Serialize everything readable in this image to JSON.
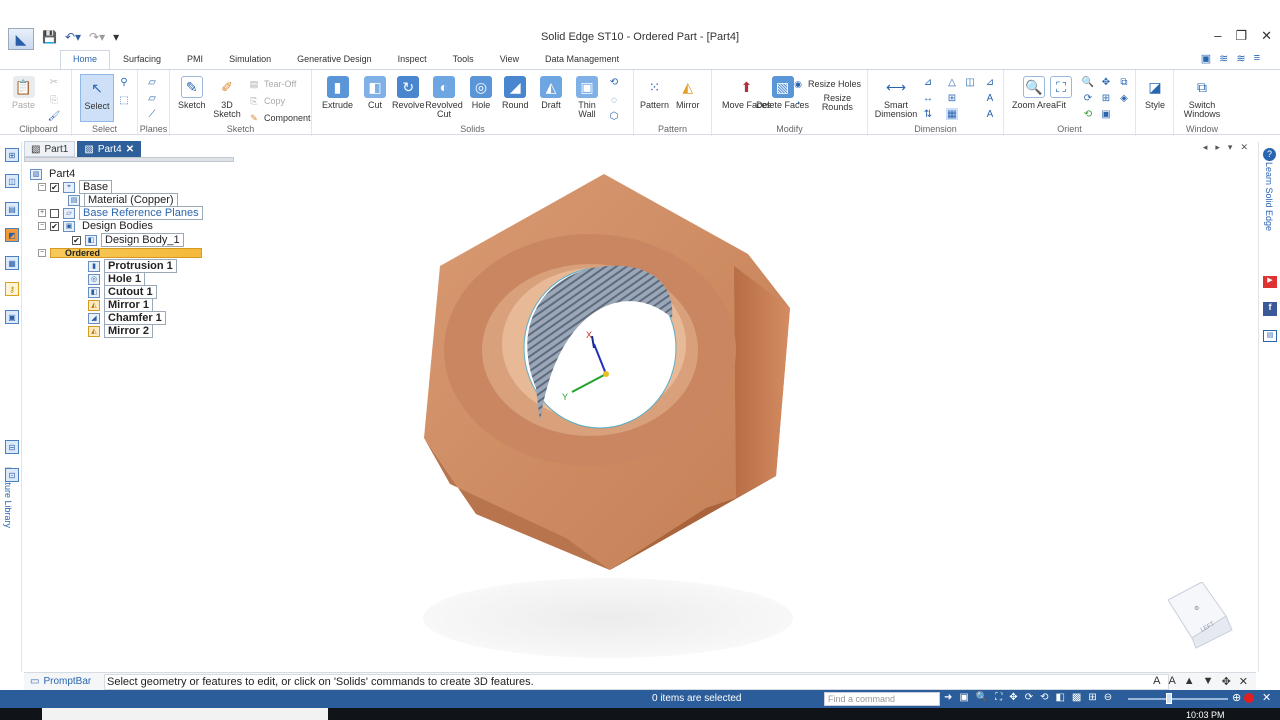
{
  "window": {
    "title": "Solid Edge ST10 - Ordered Part - [Part4]",
    "minimize": "–",
    "restore": "❐",
    "close": "✕"
  },
  "ribbon_tabs": [
    "Home",
    "Surfacing",
    "PMI",
    "Simulation",
    "Generative Design",
    "Inspect",
    "Tools",
    "View",
    "Data Management"
  ],
  "ribbon": {
    "clipboard": {
      "paste": "Paste",
      "label": "Clipboard"
    },
    "select": {
      "select": "Select",
      "label": "Select"
    },
    "planes": {
      "label": "Planes"
    },
    "sketch": {
      "sketch": "Sketch",
      "sketch3d": "3D Sketch",
      "tear_off": "Tear-Off",
      "copy": "Copy",
      "component": "Component",
      "label": "Sketch"
    },
    "solids": {
      "extrude": "Extrude",
      "cut": "Cut",
      "revolve": "Revolve",
      "revolved_cut": "Revolved Cut",
      "hole": "Hole",
      "round": "Round",
      "draft": "Draft",
      "thin_wall": "Thin Wall",
      "label": "Solids"
    },
    "pattern": {
      "pattern": "Pattern",
      "mirror": "Mirror",
      "label": "Pattern"
    },
    "modify": {
      "move_faces": "Move Faces",
      "delete_faces": "Delete Faces",
      "resize_holes": "Resize Holes",
      "resize_rounds": "Resize Rounds",
      "label": "Modify"
    },
    "dimension": {
      "smart_dimension": "Smart Dimension",
      "label": "Dimension"
    },
    "orient": {
      "zoom_area": "Zoom Area",
      "fit": "Fit",
      "label": "Orient"
    },
    "style": {
      "style": "Style"
    },
    "window": {
      "switch_windows": "Switch Windows",
      "label": "Window"
    }
  },
  "doc_tabs": [
    {
      "label": "Part1",
      "active": false
    },
    {
      "label": "Part4",
      "active": true
    }
  ],
  "tree": {
    "root": "Part4",
    "base": "Base",
    "material": "Material (Copper)",
    "base_planes": "Base Reference Planes",
    "design_bodies": "Design Bodies",
    "design_body": "Design Body_1",
    "ordered": "Ordered",
    "features": [
      "Protrusion 1",
      "Hole 1",
      "Cutout 1",
      "Mirror 1",
      "Chamfer 1",
      "Mirror 2"
    ]
  },
  "left_rail_label": "Feature Library",
  "right_rail_label": "Learn Solid Edge",
  "viewport": {
    "axis_x": "X",
    "axis_y": "Y",
    "cube_face": "LEFT",
    "part_color": "#c98558"
  },
  "promptbar": {
    "label": "PromptBar",
    "text": "Select geometry or features to edit, or click on 'Solids' commands to create 3D features."
  },
  "status": {
    "selected": "0 items are selected",
    "find_placeholder": "Find a command"
  },
  "taskbar": {
    "clock": "10:03 PM"
  }
}
